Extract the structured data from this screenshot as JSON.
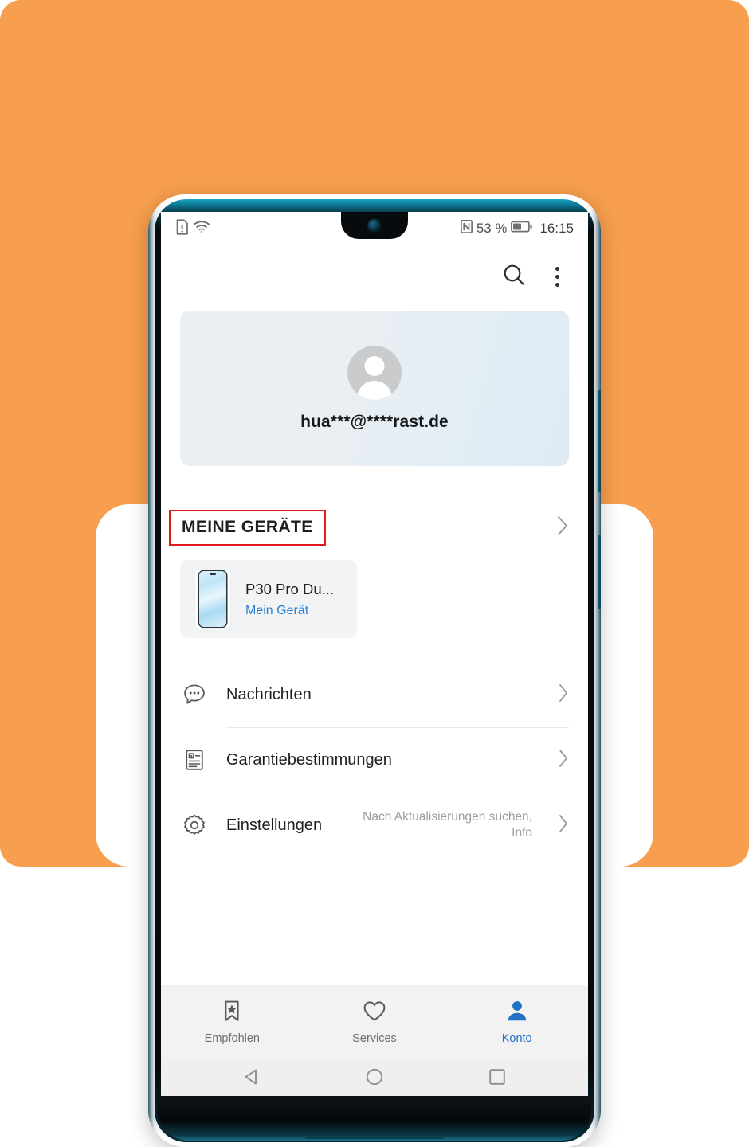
{
  "background": {
    "orange_color": "#F79F4E",
    "panel_color": "#FFFFFF"
  },
  "device": {
    "frame_accent": "#0D7F9B",
    "buttons": [
      "volume-rocker",
      "power-button"
    ]
  },
  "status_bar": {
    "left_icons": [
      "sim-card-alert-icon",
      "wifi-icon"
    ],
    "nfc_icon": "nfc-icon",
    "battery_percent": "53 %",
    "battery_icon": "battery-icon",
    "time": "16:15"
  },
  "app_bar": {
    "search_icon": "search-icon",
    "overflow_icon": "more-vertical-icon"
  },
  "profile": {
    "avatar_icon": "avatar-person-icon",
    "email": "hua***@****rast.de"
  },
  "devices_section": {
    "title": "MEINE GERÄTE",
    "highlight_color": "#E01B1B",
    "chevron_icon": "chevron-right-icon",
    "device": {
      "thumbnail_icon": "phone-thumbnail-icon",
      "name": "P30 Pro Du...",
      "tag": "Mein Gerät",
      "tag_color": "#2D7FD3"
    }
  },
  "menu": {
    "items": [
      {
        "icon": "chat-bubble-icon",
        "label": "Nachrichten",
        "subtitle": "",
        "chevron": "chevron-right-icon"
      },
      {
        "icon": "document-warranty-icon",
        "label": "Garantiebestimmungen",
        "subtitle": "",
        "chevron": "chevron-right-icon"
      },
      {
        "icon": "gear-icon",
        "label": "Einstellungen",
        "subtitle": "Nach Aktualisierungen suchen, Info",
        "chevron": "chevron-right-icon"
      }
    ]
  },
  "bottom_nav": {
    "active_color": "#1F72C4",
    "items": [
      {
        "icon": "bookmark-star-icon",
        "label": "Empfohlen",
        "active": false
      },
      {
        "icon": "heart-icon",
        "label": "Services",
        "active": false
      },
      {
        "icon": "person-icon",
        "label": "Konto",
        "active": true
      }
    ]
  },
  "android_nav": {
    "back_icon": "back-triangle-icon",
    "home_icon": "home-circle-icon",
    "recents_icon": "recents-square-icon"
  }
}
